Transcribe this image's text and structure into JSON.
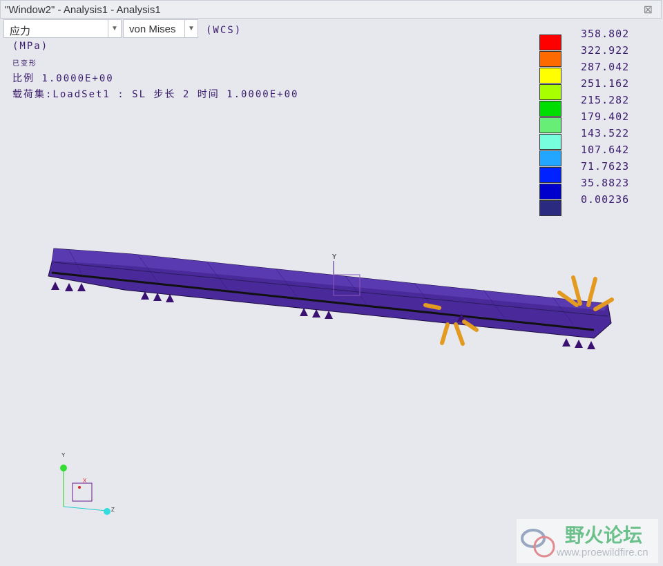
{
  "window": {
    "title": "\"Window2\" - Analysis1 - Analysis1",
    "close": "⊠"
  },
  "toolbar": {
    "quantity": "应力",
    "component": "von Mises",
    "coord": "(WCS)"
  },
  "info": {
    "units": "(MPa)",
    "deformed": "已变形",
    "scale": "比例  1.0000E+00",
    "loadset": "载荷集:LoadSet1 :  SL 步长 2 时间  1.0000E+00"
  },
  "legend": {
    "values": [
      "358.802",
      "322.922",
      "287.042",
      "251.162",
      "215.282",
      "179.402",
      "143.522",
      "107.642",
      "71.7623",
      "35.8823",
      "0.00236"
    ],
    "colors": [
      "#ff0000",
      "#ff6a00",
      "#ffff00",
      "#a8ff00",
      "#00dd00",
      "#66ee77",
      "#77ffdd",
      "#22a6ff",
      "#0022ff",
      "#0000cc",
      "#2a2a80"
    ]
  },
  "triad": {
    "y": "Y",
    "z": "Z",
    "x": "X"
  },
  "watermark": {
    "name": "野火论坛",
    "url": "www.proewildfire.cn"
  }
}
